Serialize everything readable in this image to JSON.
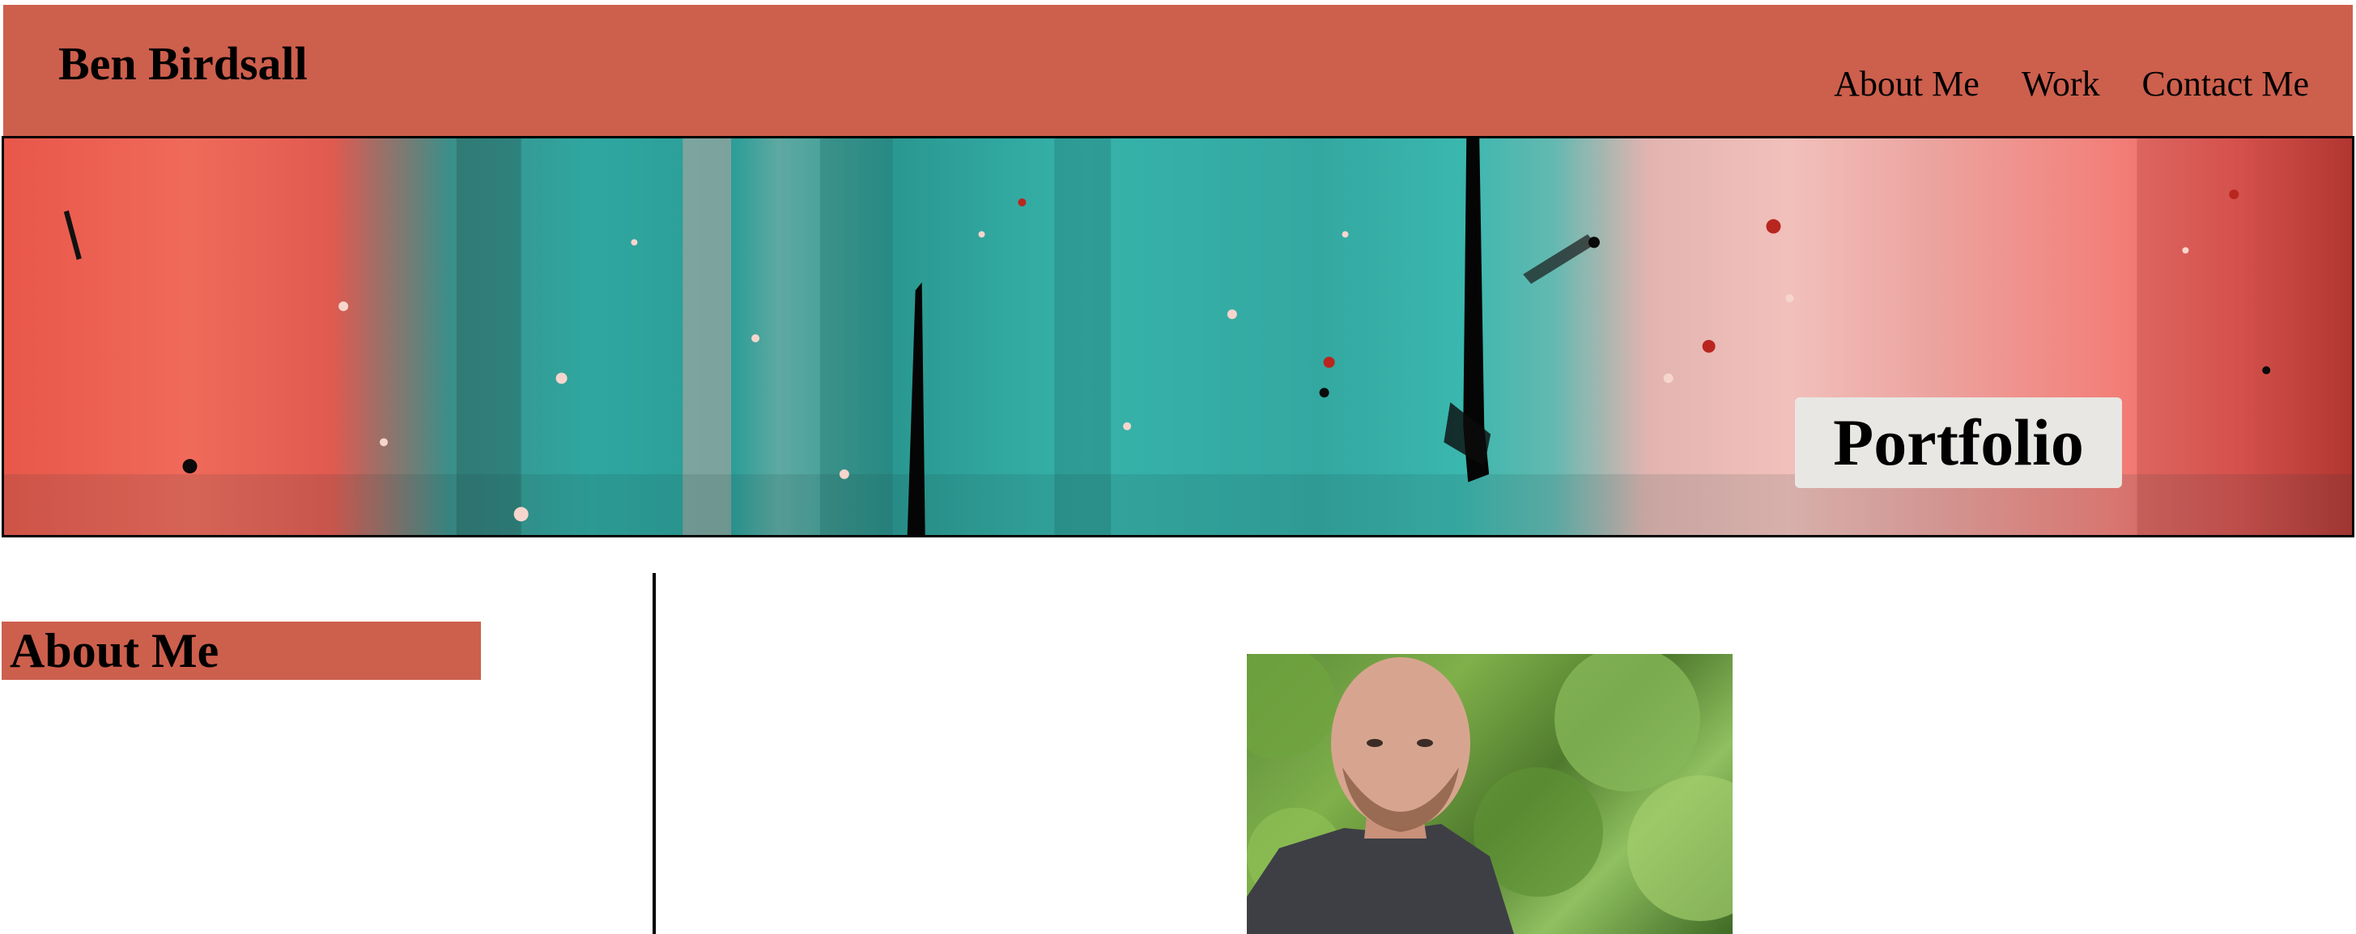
{
  "header": {
    "brand": "Ben Birdsall",
    "nav": [
      {
        "label": "About Me"
      },
      {
        "label": "Work"
      },
      {
        "label": "Contact Me"
      }
    ]
  },
  "hero": {
    "badge": "Portfolio"
  },
  "about": {
    "heading": "About Me"
  },
  "colors": {
    "accent": "#cd5f4d",
    "badge_bg": "#e8e7e3",
    "text": "#000000"
  }
}
